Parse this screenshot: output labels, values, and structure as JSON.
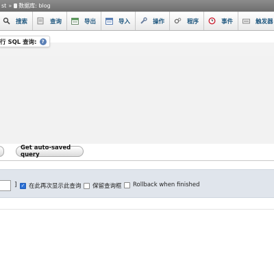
{
  "breadcrumb": {
    "server_fragment": "st",
    "separator": "»",
    "database": "数据库: blog"
  },
  "tabs": [
    {
      "label": "搜索",
      "icon": "search-icon"
    },
    {
      "label": "查询",
      "icon": "query-icon"
    },
    {
      "label": "导出",
      "icon": "export-icon"
    },
    {
      "label": "导入",
      "icon": "import-icon"
    },
    {
      "label": "操作",
      "icon": "wrench-icon"
    },
    {
      "label": "程序",
      "icon": "routines-icon"
    },
    {
      "label": "事件",
      "icon": "clock-icon"
    },
    {
      "label": "触发器",
      "icon": "triggers-icon"
    }
  ],
  "sql_panel": {
    "title": "行 SQL 查询:",
    "help_icon": "help-icon"
  },
  "buttons": {
    "autosave": "Get auto-saved query"
  },
  "options": {
    "bracket": "]",
    "show_again_label": "在此再次显示此查询",
    "show_again_checked": true,
    "retain_box_label": "保留查询框",
    "retain_box_checked": false,
    "rollback_label": "Rollback when finished",
    "rollback_checked": false
  },
  "colors": {
    "tab_text": "#235a81",
    "breadcrumb_bg": "#7d7d7d",
    "options_bg": "#e0e5ec",
    "checkbox_checked": "#2a6fd6"
  }
}
